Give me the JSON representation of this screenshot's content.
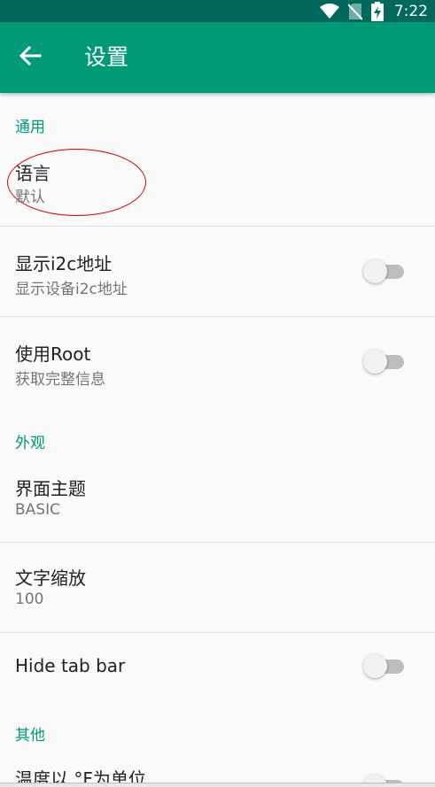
{
  "status_bar": {
    "time": "7:22",
    "icons": [
      "wifi-icon",
      "no-sim-icon",
      "battery-charging-icon"
    ]
  },
  "toolbar": {
    "title": "设置",
    "back_icon": "arrow-back-icon"
  },
  "categories": {
    "general": "通用",
    "appearance": "外观",
    "other": "其他"
  },
  "prefs": {
    "language": {
      "title": "语言",
      "summary": "默认"
    },
    "show_i2c": {
      "title": "显示i2c地址",
      "summary": "显示设备i2c地址",
      "switch_on": false
    },
    "use_root": {
      "title": "使用Root",
      "summary": "获取完整信息",
      "switch_on": false
    },
    "theme": {
      "title": "界面主题",
      "summary": "BASIC"
    },
    "text_scale": {
      "title": "文字缩放",
      "summary": "100"
    },
    "hide_tab_bar": {
      "title": "Hide tab bar",
      "switch_on": false
    },
    "temperature": {
      "title": "温度以 °F为单位",
      "switch_on": false
    }
  },
  "colors": {
    "status_bar": "#00695c",
    "toolbar": "#009a77",
    "accent": "#009a77",
    "annotation": "#d40000"
  }
}
